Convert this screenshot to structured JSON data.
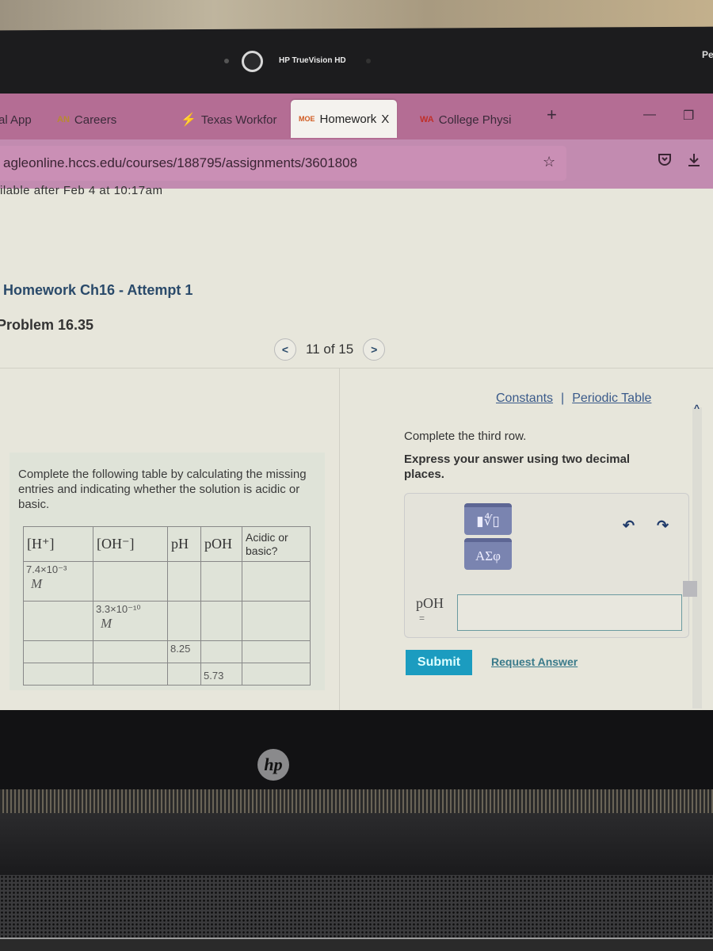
{
  "device": {
    "webcam_label": "HP TrueVision HD",
    "corner_text": "Pe",
    "logo": "hp"
  },
  "browser": {
    "tabs": [
      {
        "label": "al App",
        "favicon": "",
        "active": false
      },
      {
        "label": "Careers",
        "favicon": "AN",
        "active": false
      },
      {
        "label": "Texas Workfor",
        "favicon": "lightning-icon",
        "active": false
      },
      {
        "label": "Homework",
        "favicon": "MOE",
        "active": true,
        "close": "X"
      },
      {
        "label": "College Physi",
        "favicon": "WA",
        "active": false
      }
    ],
    "new_tab": "+",
    "minimize": "—",
    "restore": "❐",
    "url": "agleonline.hccs.edu/courses/188795/assignments/3601808",
    "icons": {
      "bookmark": "☆",
      "pocket": "pocket-icon",
      "download": "⤓"
    }
  },
  "page": {
    "availability": "ilable   after Feb 4 at 10:17am",
    "assignment_title": "Homework Ch16 - Attempt 1",
    "problem_title": "Problem 16.35",
    "pager": {
      "prev": "<",
      "text": "11 of 15",
      "next": ">"
    },
    "problem": {
      "instructions": "Complete the following table by calculating the missing entries and indicating whether the solution is acidic or basic.",
      "table": {
        "headers": [
          "[H⁺]",
          "[OH⁻]",
          "pH",
          "pOH",
          "Acidic or basic?"
        ],
        "rows": [
          {
            "h": "7.4×10⁻³",
            "h_unit": "M",
            "oh": "",
            "oh_unit": "",
            "ph": "",
            "poh": "",
            "ab": ""
          },
          {
            "h": "",
            "h_unit": "",
            "oh": "3.3×10⁻¹⁰",
            "oh_unit": "M",
            "ph": "",
            "poh": "",
            "ab": ""
          },
          {
            "h": "",
            "h_unit": "",
            "oh": "",
            "oh_unit": "",
            "ph": "8.25",
            "poh": "",
            "ab": ""
          },
          {
            "h": "",
            "h_unit": "",
            "oh": "",
            "oh_unit": "",
            "ph": "",
            "poh": "5.73",
            "ab": ""
          }
        ]
      }
    },
    "links": {
      "constants": "Constants",
      "separator": "|",
      "periodic_table": "Periodic Table"
    },
    "question": {
      "prompt": "Complete the third row.",
      "instruction": "Express your answer using two decimal places.",
      "tools": {
        "templates": "▮∜▯",
        "symbols": "ΑΣφ",
        "undo": "↶",
        "redo": "↷"
      },
      "answer_label": "pOH",
      "answer_eq": "=",
      "answer_value": "",
      "submit": "Submit",
      "request_answer": "Request Answer"
    }
  }
}
